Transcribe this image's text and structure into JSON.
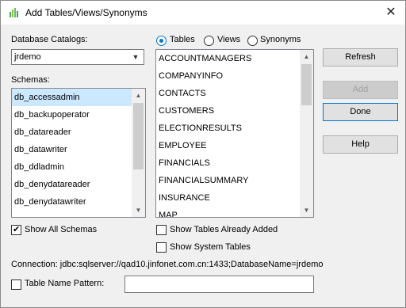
{
  "window": {
    "title": "Add Tables/Views/Synonyms",
    "close_glyph": "✕"
  },
  "catalog": {
    "label": "Database Catalogs:",
    "value": "jrdemo"
  },
  "schemas": {
    "label": "Schemas:",
    "items": [
      "db_accessadmin",
      "db_backupoperator",
      "db_datareader",
      "db_datawriter",
      "db_ddladmin",
      "db_denydatareader",
      "db_denydatawriter",
      "..."
    ],
    "selected_index": 0
  },
  "object_type": {
    "options": [
      "Tables",
      "Views",
      "Synonyms"
    ],
    "selected": "Tables"
  },
  "tables": {
    "items": [
      "ACCOUNTMANAGERS",
      "COMPANYINFO",
      "CONTACTS",
      "CUSTOMERS",
      "ELECTIONRESULTS",
      "EMPLOYEE",
      "FINANCIALS",
      "FINANCIALSUMMARY",
      "INSURANCE",
      "MAP"
    ]
  },
  "buttons": {
    "refresh": "Refresh",
    "add": "Add",
    "done": "Done",
    "help": "Help"
  },
  "checkboxes": {
    "show_all_schemas": {
      "label": "Show All Schemas",
      "checked": true
    },
    "show_tables_added": {
      "label": "Show Tables Already Added",
      "checked": false
    },
    "show_system_tables": {
      "label": "Show System Tables",
      "checked": false
    },
    "table_name_pattern": {
      "label": "Table Name Pattern:",
      "checked": false
    }
  },
  "pattern_value": "",
  "connection": {
    "text": "Connection: jdbc:sqlserver://qad10.jinfonet.com.cn:1433;DatabaseName=jrdemo"
  },
  "icons": {
    "app": "grid-icon",
    "scroll_up": "▲",
    "scroll_down": "▼",
    "dropdown": "▼"
  },
  "colors": {
    "selection": "#cce8ff",
    "accent": "#0078d7"
  }
}
